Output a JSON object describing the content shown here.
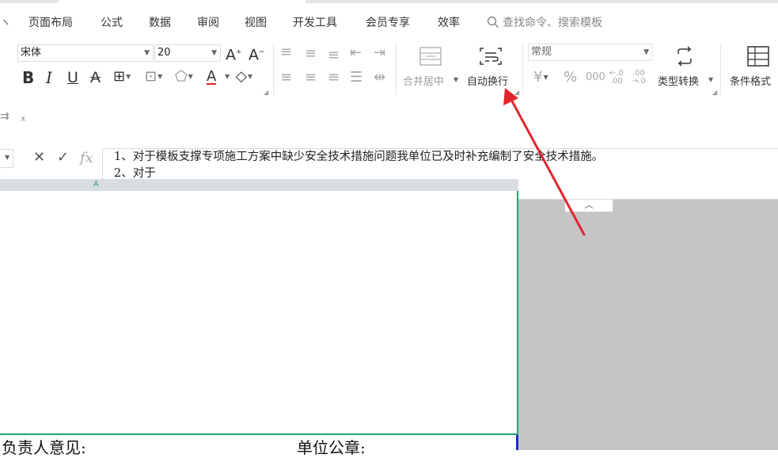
{
  "menu_tabs": [
    "页面布局",
    "公式",
    "数据",
    "审阅",
    "视图",
    "开发工具",
    "会员专享",
    "效率"
  ],
  "search": {
    "placeholder": "查找命令、搜索模板"
  },
  "font": {
    "name": "宋体",
    "size": "20"
  },
  "number_format": "常规",
  "ribbon": {
    "merge_center": "合并居中",
    "wrap_text": "自动换行",
    "type_convert": "类型转换",
    "cond_format": "条件格式"
  },
  "formula": {
    "fx_label": "fx",
    "lines": [
      "1、对于模板支撑专项施工方案中缺少安全技术措施问题我单位已及时补充编制了安全技术措施。",
      "2、对于"
    ]
  },
  "sheet": {
    "column_marker": "A",
    "bottom_left_text": "负责人意见:",
    "bottom_right_text": "单位公章:"
  },
  "colors": {
    "selection_border": "#2aa36d",
    "annotation_arrow": "#e0262f",
    "grey_area": "#c6c4c6"
  }
}
